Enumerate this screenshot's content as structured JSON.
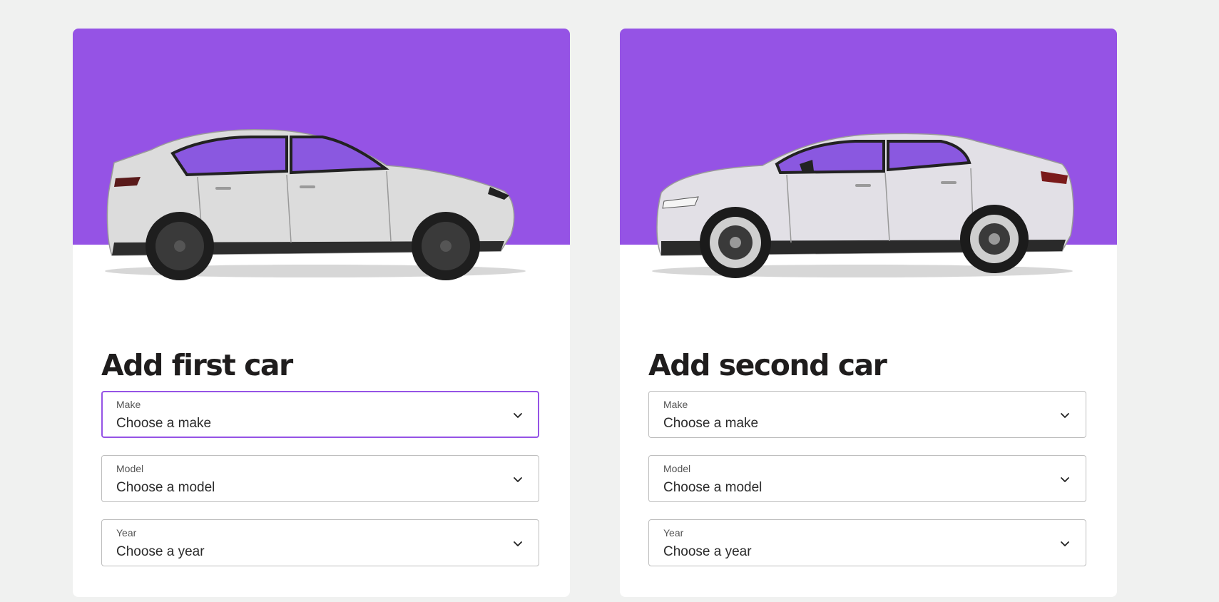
{
  "cars": [
    {
      "title": "Add first car",
      "fields": [
        {
          "label": "Make",
          "value": "Choose a make"
        },
        {
          "label": "Model",
          "value": "Choose a model"
        },
        {
          "label": "Year",
          "value": "Choose a year"
        }
      ]
    },
    {
      "title": "Add second car",
      "fields": [
        {
          "label": "Make",
          "value": "Choose a make"
        },
        {
          "label": "Model",
          "value": "Choose a model"
        },
        {
          "label": "Year",
          "value": "Choose a year"
        }
      ]
    }
  ],
  "colors": {
    "accent": "#9553e5",
    "background": "#f0f1f0",
    "title_text": "#1f1d1d"
  },
  "icons": {
    "dropdown": "chevron-down-icon"
  }
}
